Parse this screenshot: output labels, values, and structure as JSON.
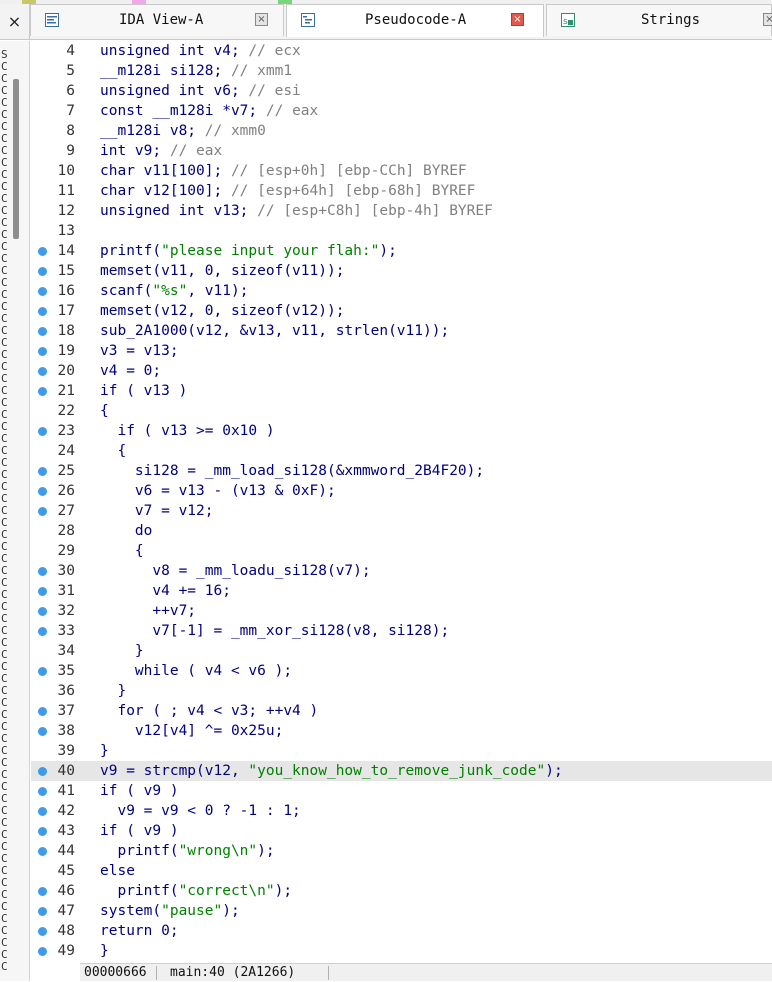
{
  "colors": {
    "breakpoint": "#3d9be9",
    "keyword": "#000080",
    "comment": "#808080",
    "string": "#008000",
    "highlight": "#e6e6e6"
  },
  "window": {
    "close_glyph": "×"
  },
  "tabs": [
    {
      "label": "IDA View-A",
      "icon": "ida-view-icon",
      "close_glyph": "×",
      "active": false
    },
    {
      "label": "Pseudocode-A",
      "icon": "pseudocode-icon",
      "close_glyph": "×",
      "active": true
    },
    {
      "label": "Strings",
      "icon": "strings-icon",
      "close_glyph": "×",
      "active": false
    }
  ],
  "left_strip": {
    "chars": [
      "S",
      "C",
      "C",
      "C",
      "C",
      "C",
      "C",
      "C",
      "C",
      "C",
      "C",
      "C",
      "C",
      "C",
      "C",
      "C",
      "C",
      "C",
      "C",
      "C",
      "C",
      "C",
      "C",
      "C",
      "C",
      "C",
      "C",
      "C",
      "C",
      "C",
      "C",
      "C",
      "C",
      "C",
      "C",
      "C",
      "C",
      "C",
      "C",
      "C",
      "C",
      "C",
      "C",
      "C",
      "C",
      "C",
      "C",
      "C",
      "C",
      "C",
      "C",
      "C",
      "C",
      "C",
      "C",
      "C",
      "C",
      "C",
      "C",
      "C",
      "C",
      "C",
      "C",
      "C",
      "C",
      "C",
      "C",
      "C",
      "C",
      "C",
      "C",
      "C",
      "C",
      "C",
      "C",
      "C",
      "C"
    ]
  },
  "code_lines": [
    {
      "num": "4",
      "bp": false,
      "hl": false,
      "text": "unsigned int v4; // ecx"
    },
    {
      "num": "5",
      "bp": false,
      "hl": false,
      "text": "__m128i si128; // xmm1"
    },
    {
      "num": "6",
      "bp": false,
      "hl": false,
      "text": "unsigned int v6; // esi"
    },
    {
      "num": "7",
      "bp": false,
      "hl": false,
      "text": "const __m128i *v7; // eax"
    },
    {
      "num": "8",
      "bp": false,
      "hl": false,
      "text": "__m128i v8; // xmm0"
    },
    {
      "num": "9",
      "bp": false,
      "hl": false,
      "text": "int v9; // eax"
    },
    {
      "num": "10",
      "bp": false,
      "hl": false,
      "text": "char v11[100]; // [esp+0h] [ebp-CCh] BYREF"
    },
    {
      "num": "11",
      "bp": false,
      "hl": false,
      "text": "char v12[100]; // [esp+64h] [ebp-68h] BYREF"
    },
    {
      "num": "12",
      "bp": false,
      "hl": false,
      "text": "unsigned int v13; // [esp+C8h] [ebp-4h] BYREF"
    },
    {
      "num": "13",
      "bp": false,
      "hl": false,
      "text": ""
    },
    {
      "num": "14",
      "bp": true,
      "hl": false,
      "text": "printf(\"please input your flah:\");"
    },
    {
      "num": "15",
      "bp": true,
      "hl": false,
      "text": "memset(v11, 0, sizeof(v11));"
    },
    {
      "num": "16",
      "bp": true,
      "hl": false,
      "text": "scanf(\"%s\", v11);"
    },
    {
      "num": "17",
      "bp": true,
      "hl": false,
      "text": "memset(v12, 0, sizeof(v12));"
    },
    {
      "num": "18",
      "bp": true,
      "hl": false,
      "text": "sub_2A1000(v12, &v13, v11, strlen(v11));"
    },
    {
      "num": "19",
      "bp": true,
      "hl": false,
      "text": "v3 = v13;"
    },
    {
      "num": "20",
      "bp": true,
      "hl": false,
      "text": "v4 = 0;"
    },
    {
      "num": "21",
      "bp": true,
      "hl": false,
      "text": "if ( v13 )"
    },
    {
      "num": "22",
      "bp": false,
      "hl": false,
      "text": "{"
    },
    {
      "num": "23",
      "bp": true,
      "hl": false,
      "text": "  if ( v13 >= 0x10 )"
    },
    {
      "num": "24",
      "bp": false,
      "hl": false,
      "text": "  {"
    },
    {
      "num": "25",
      "bp": true,
      "hl": false,
      "text": "    si128 = _mm_load_si128(&xmmword_2B4F20);"
    },
    {
      "num": "26",
      "bp": true,
      "hl": false,
      "text": "    v6 = v13 - (v13 & 0xF);"
    },
    {
      "num": "27",
      "bp": true,
      "hl": false,
      "text": "    v7 = v12;"
    },
    {
      "num": "28",
      "bp": false,
      "hl": false,
      "text": "    do"
    },
    {
      "num": "29",
      "bp": false,
      "hl": false,
      "text": "    {"
    },
    {
      "num": "30",
      "bp": true,
      "hl": false,
      "text": "      v8 = _mm_loadu_si128(v7);"
    },
    {
      "num": "31",
      "bp": true,
      "hl": false,
      "text": "      v4 += 16;"
    },
    {
      "num": "32",
      "bp": true,
      "hl": false,
      "text": "      ++v7;"
    },
    {
      "num": "33",
      "bp": true,
      "hl": false,
      "text": "      v7[-1] = _mm_xor_si128(v8, si128);"
    },
    {
      "num": "34",
      "bp": false,
      "hl": false,
      "text": "    }"
    },
    {
      "num": "35",
      "bp": true,
      "hl": false,
      "text": "    while ( v4 < v6 );"
    },
    {
      "num": "36",
      "bp": false,
      "hl": false,
      "text": "  }"
    },
    {
      "num": "37",
      "bp": true,
      "hl": false,
      "text": "  for ( ; v4 < v3; ++v4 )"
    },
    {
      "num": "38",
      "bp": true,
      "hl": false,
      "text": "    v12[v4] ^= 0x25u;"
    },
    {
      "num": "39",
      "bp": false,
      "hl": false,
      "text": "}"
    },
    {
      "num": "40",
      "bp": true,
      "hl": true,
      "text": "v9 = strcmp(v12, \"you_know_how_to_remove_junk_code\");"
    },
    {
      "num": "41",
      "bp": true,
      "hl": false,
      "text": "if ( v9 )"
    },
    {
      "num": "42",
      "bp": true,
      "hl": false,
      "text": "  v9 = v9 < 0 ? -1 : 1;"
    },
    {
      "num": "43",
      "bp": true,
      "hl": false,
      "text": "if ( v9 )"
    },
    {
      "num": "44",
      "bp": true,
      "hl": false,
      "text": "  printf(\"wrong\\n\");"
    },
    {
      "num": "45",
      "bp": false,
      "hl": false,
      "text": "else"
    },
    {
      "num": "46",
      "bp": true,
      "hl": false,
      "text": "  printf(\"correct\\n\");"
    },
    {
      "num": "47",
      "bp": true,
      "hl": false,
      "text": "system(\"pause\");"
    },
    {
      "num": "48",
      "bp": true,
      "hl": false,
      "text": "return 0;"
    },
    {
      "num": "49",
      "bp": true,
      "hl": false,
      "text": "}"
    }
  ],
  "status": {
    "address": "00000666",
    "location": "main:40 (2A1266)"
  }
}
